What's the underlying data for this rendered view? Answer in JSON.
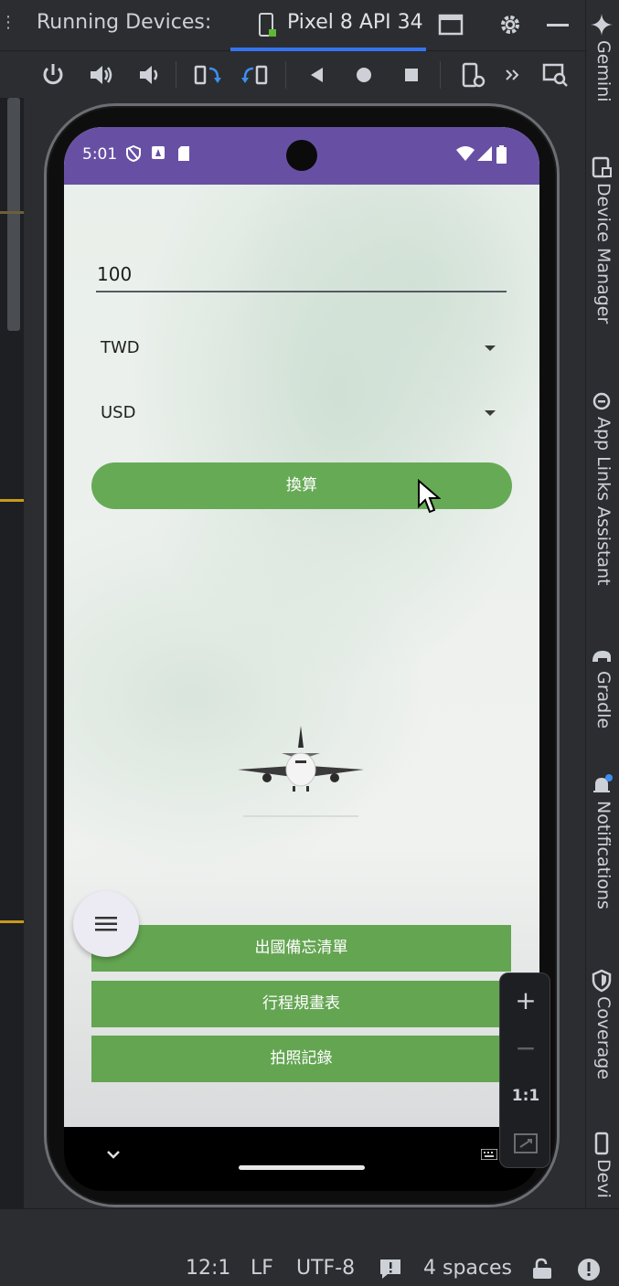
{
  "ide": {
    "panel_title": "Running Devices:",
    "device_tab": "Pixel 8 API 34",
    "right_tools": [
      "Gemini",
      "Device Manager",
      "App Links Assistant",
      "Gradle",
      "Notifications",
      "Coverage",
      "Devi"
    ],
    "status": {
      "position": "12:1",
      "line_ending": "LF",
      "encoding": "UTF-8",
      "indent": "4 spaces"
    },
    "zoom": {
      "zoom_in": "+",
      "zoom_out": "−",
      "actual_size": "1:1"
    }
  },
  "phone": {
    "time": "5:01"
  },
  "app": {
    "amount_value": "100",
    "from_currency": "TWD",
    "to_currency": "USD",
    "convert_label": "換算",
    "checklist_label": "出國備忘清單",
    "itinerary_label": "行程規畫表",
    "photo_label": "拍照記錄"
  },
  "colors": {
    "accent": "#3574f0",
    "status_bar": "#6750a4",
    "button_green": "#67aa56"
  }
}
